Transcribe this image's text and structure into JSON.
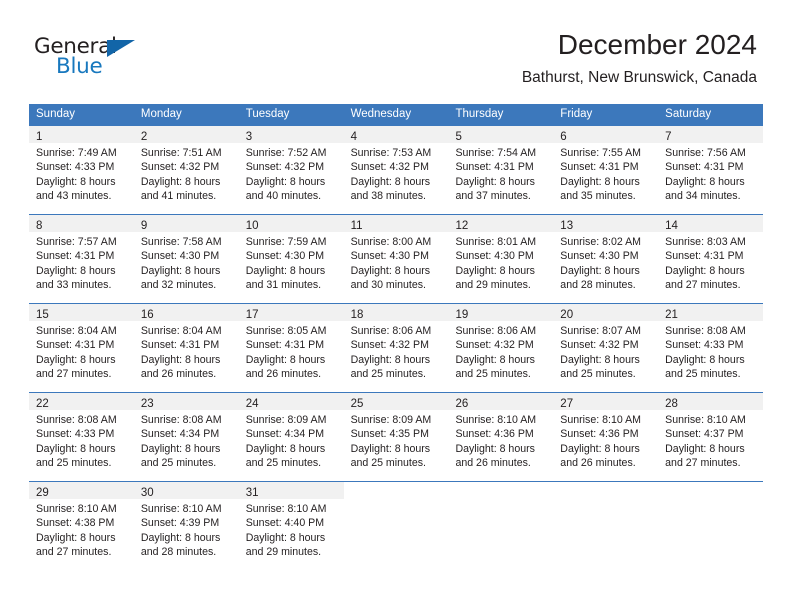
{
  "brand": {
    "word_top": "General",
    "word_bottom": "Blue",
    "triangle_color": "#1265a8",
    "blue_text_color": "#1878be"
  },
  "header": {
    "title": "December 2024",
    "subtitle": "Bathurst, New Brunswick, Canada"
  },
  "colors": {
    "header_row_bg": "#3c78bc",
    "day_number_band_bg": "#f1f1f1",
    "text": "#231f20",
    "row_separator": "#3c78bc"
  },
  "weekday_headers": [
    "Sunday",
    "Monday",
    "Tuesday",
    "Wednesday",
    "Thursday",
    "Friday",
    "Saturday"
  ],
  "weeks": [
    [
      {
        "day": "1",
        "sunrise": "Sunrise: 7:49 AM",
        "sunset": "Sunset: 4:33 PM",
        "daylight1": "Daylight: 8 hours",
        "daylight2": "and 43 minutes."
      },
      {
        "day": "2",
        "sunrise": "Sunrise: 7:51 AM",
        "sunset": "Sunset: 4:32 PM",
        "daylight1": "Daylight: 8 hours",
        "daylight2": "and 41 minutes."
      },
      {
        "day": "3",
        "sunrise": "Sunrise: 7:52 AM",
        "sunset": "Sunset: 4:32 PM",
        "daylight1": "Daylight: 8 hours",
        "daylight2": "and 40 minutes."
      },
      {
        "day": "4",
        "sunrise": "Sunrise: 7:53 AM",
        "sunset": "Sunset: 4:32 PM",
        "daylight1": "Daylight: 8 hours",
        "daylight2": "and 38 minutes."
      },
      {
        "day": "5",
        "sunrise": "Sunrise: 7:54 AM",
        "sunset": "Sunset: 4:31 PM",
        "daylight1": "Daylight: 8 hours",
        "daylight2": "and 37 minutes."
      },
      {
        "day": "6",
        "sunrise": "Sunrise: 7:55 AM",
        "sunset": "Sunset: 4:31 PM",
        "daylight1": "Daylight: 8 hours",
        "daylight2": "and 35 minutes."
      },
      {
        "day": "7",
        "sunrise": "Sunrise: 7:56 AM",
        "sunset": "Sunset: 4:31 PM",
        "daylight1": "Daylight: 8 hours",
        "daylight2": "and 34 minutes."
      }
    ],
    [
      {
        "day": "8",
        "sunrise": "Sunrise: 7:57 AM",
        "sunset": "Sunset: 4:31 PM",
        "daylight1": "Daylight: 8 hours",
        "daylight2": "and 33 minutes."
      },
      {
        "day": "9",
        "sunrise": "Sunrise: 7:58 AM",
        "sunset": "Sunset: 4:30 PM",
        "daylight1": "Daylight: 8 hours",
        "daylight2": "and 32 minutes."
      },
      {
        "day": "10",
        "sunrise": "Sunrise: 7:59 AM",
        "sunset": "Sunset: 4:30 PM",
        "daylight1": "Daylight: 8 hours",
        "daylight2": "and 31 minutes."
      },
      {
        "day": "11",
        "sunrise": "Sunrise: 8:00 AM",
        "sunset": "Sunset: 4:30 PM",
        "daylight1": "Daylight: 8 hours",
        "daylight2": "and 30 minutes."
      },
      {
        "day": "12",
        "sunrise": "Sunrise: 8:01 AM",
        "sunset": "Sunset: 4:30 PM",
        "daylight1": "Daylight: 8 hours",
        "daylight2": "and 29 minutes."
      },
      {
        "day": "13",
        "sunrise": "Sunrise: 8:02 AM",
        "sunset": "Sunset: 4:30 PM",
        "daylight1": "Daylight: 8 hours",
        "daylight2": "and 28 minutes."
      },
      {
        "day": "14",
        "sunrise": "Sunrise: 8:03 AM",
        "sunset": "Sunset: 4:31 PM",
        "daylight1": "Daylight: 8 hours",
        "daylight2": "and 27 minutes."
      }
    ],
    [
      {
        "day": "15",
        "sunrise": "Sunrise: 8:04 AM",
        "sunset": "Sunset: 4:31 PM",
        "daylight1": "Daylight: 8 hours",
        "daylight2": "and 27 minutes."
      },
      {
        "day": "16",
        "sunrise": "Sunrise: 8:04 AM",
        "sunset": "Sunset: 4:31 PM",
        "daylight1": "Daylight: 8 hours",
        "daylight2": "and 26 minutes."
      },
      {
        "day": "17",
        "sunrise": "Sunrise: 8:05 AM",
        "sunset": "Sunset: 4:31 PM",
        "daylight1": "Daylight: 8 hours",
        "daylight2": "and 26 minutes."
      },
      {
        "day": "18",
        "sunrise": "Sunrise: 8:06 AM",
        "sunset": "Sunset: 4:32 PM",
        "daylight1": "Daylight: 8 hours",
        "daylight2": "and 25 minutes."
      },
      {
        "day": "19",
        "sunrise": "Sunrise: 8:06 AM",
        "sunset": "Sunset: 4:32 PM",
        "daylight1": "Daylight: 8 hours",
        "daylight2": "and 25 minutes."
      },
      {
        "day": "20",
        "sunrise": "Sunrise: 8:07 AM",
        "sunset": "Sunset: 4:32 PM",
        "daylight1": "Daylight: 8 hours",
        "daylight2": "and 25 minutes."
      },
      {
        "day": "21",
        "sunrise": "Sunrise: 8:08 AM",
        "sunset": "Sunset: 4:33 PM",
        "daylight1": "Daylight: 8 hours",
        "daylight2": "and 25 minutes."
      }
    ],
    [
      {
        "day": "22",
        "sunrise": "Sunrise: 8:08 AM",
        "sunset": "Sunset: 4:33 PM",
        "daylight1": "Daylight: 8 hours",
        "daylight2": "and 25 minutes."
      },
      {
        "day": "23",
        "sunrise": "Sunrise: 8:08 AM",
        "sunset": "Sunset: 4:34 PM",
        "daylight1": "Daylight: 8 hours",
        "daylight2": "and 25 minutes."
      },
      {
        "day": "24",
        "sunrise": "Sunrise: 8:09 AM",
        "sunset": "Sunset: 4:34 PM",
        "daylight1": "Daylight: 8 hours",
        "daylight2": "and 25 minutes."
      },
      {
        "day": "25",
        "sunrise": "Sunrise: 8:09 AM",
        "sunset": "Sunset: 4:35 PM",
        "daylight1": "Daylight: 8 hours",
        "daylight2": "and 25 minutes."
      },
      {
        "day": "26",
        "sunrise": "Sunrise: 8:10 AM",
        "sunset": "Sunset: 4:36 PM",
        "daylight1": "Daylight: 8 hours",
        "daylight2": "and 26 minutes."
      },
      {
        "day": "27",
        "sunrise": "Sunrise: 8:10 AM",
        "sunset": "Sunset: 4:36 PM",
        "daylight1": "Daylight: 8 hours",
        "daylight2": "and 26 minutes."
      },
      {
        "day": "28",
        "sunrise": "Sunrise: 8:10 AM",
        "sunset": "Sunset: 4:37 PM",
        "daylight1": "Daylight: 8 hours",
        "daylight2": "and 27 minutes."
      }
    ],
    [
      {
        "day": "29",
        "sunrise": "Sunrise: 8:10 AM",
        "sunset": "Sunset: 4:38 PM",
        "daylight1": "Daylight: 8 hours",
        "daylight2": "and 27 minutes."
      },
      {
        "day": "30",
        "sunrise": "Sunrise: 8:10 AM",
        "sunset": "Sunset: 4:39 PM",
        "daylight1": "Daylight: 8 hours",
        "daylight2": "and 28 minutes."
      },
      {
        "day": "31",
        "sunrise": "Sunrise: 8:10 AM",
        "sunset": "Sunset: 4:40 PM",
        "daylight1": "Daylight: 8 hours",
        "daylight2": "and 29 minutes."
      },
      {
        "day": "",
        "sunrise": "",
        "sunset": "",
        "daylight1": "",
        "daylight2": ""
      },
      {
        "day": "",
        "sunrise": "",
        "sunset": "",
        "daylight1": "",
        "daylight2": ""
      },
      {
        "day": "",
        "sunrise": "",
        "sunset": "",
        "daylight1": "",
        "daylight2": ""
      },
      {
        "day": "",
        "sunrise": "",
        "sunset": "",
        "daylight1": "",
        "daylight2": ""
      }
    ]
  ]
}
